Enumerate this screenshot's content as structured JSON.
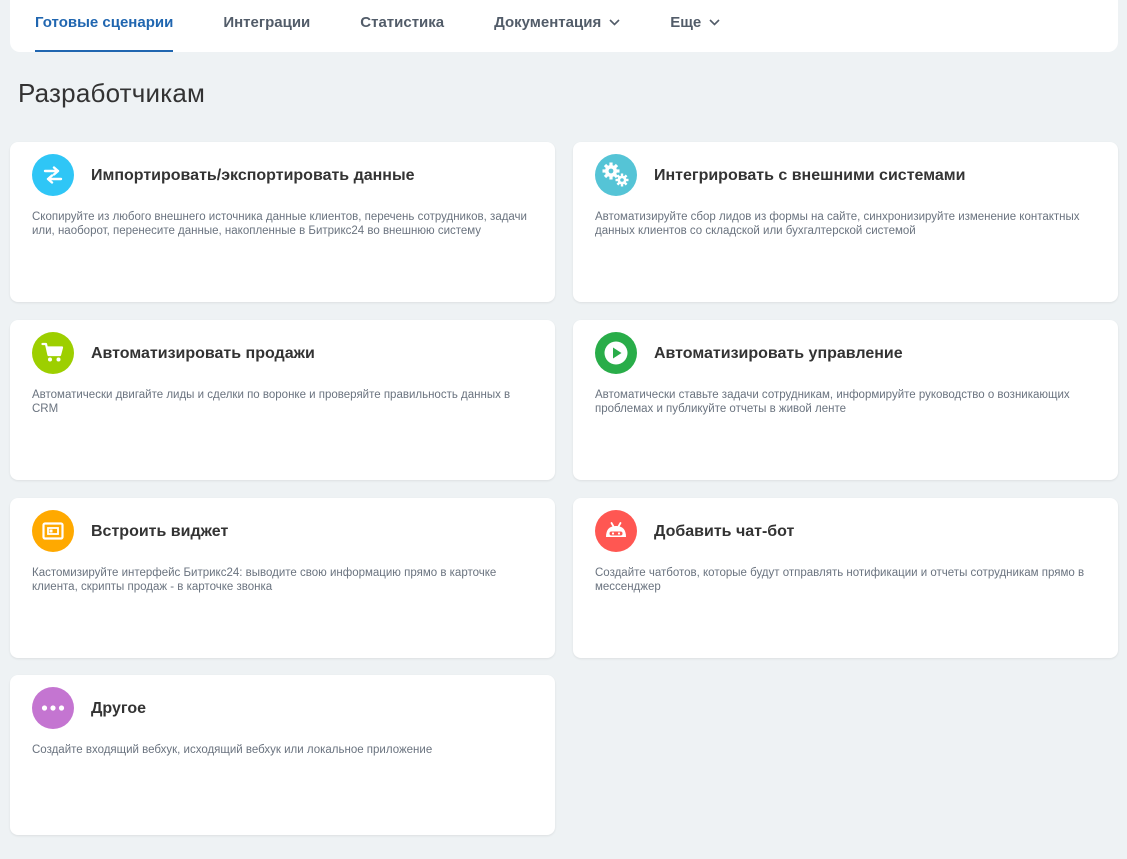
{
  "nav": {
    "tabs": [
      {
        "label": "Готовые сценарии",
        "active": true
      },
      {
        "label": "Интеграции"
      },
      {
        "label": "Статистика"
      },
      {
        "label": "Документация"
      },
      {
        "label": "Еще"
      }
    ]
  },
  "page": {
    "title": "Разработчикам"
  },
  "cards": [
    {
      "title": "Импортировать/экспортировать данные",
      "desc": "Скопируйте из любого внешнего источника данные клиентов, перечень сотрудников, задачи или, наоборот, перенесите данные, накопленные в Битрикс24 во внешнюю систему",
      "icon": "arrows-exchange-icon",
      "color": "#2fc6f6"
    },
    {
      "title": "Интегрировать с внешними системами",
      "desc": "Автоматизируйте сбор лидов из формы на сайте, синхронизируйте изменение контактных данных клиентов со складской или бухгалтерской системой",
      "icon": "gears-icon",
      "color": "#55c4d6"
    },
    {
      "title": "Автоматизировать продажи",
      "desc": "Автоматически двигайте лиды и сделки по воронке и проверяйте правильность данных в CRM",
      "icon": "cart-icon",
      "color": "#9dcf00"
    },
    {
      "title": "Автоматизировать управление",
      "desc": "Автоматически ставьте задачи сотрудникам, информируйте руководство о возникающих проблемах и публикуйте отчеты в живой ленте",
      "icon": "play-icon",
      "color": "#29ad49"
    },
    {
      "title": "Встроить виджет",
      "desc": "Кастомизируйте интерфейс Битрикс24: выводите свою информацию прямо в карточке клиента, скрипты продаж - в карточке звонка",
      "icon": "widget-icon",
      "color": "#ffa900"
    },
    {
      "title": "Добавить чат-бот",
      "desc": "Создайте чатботов, которые будут отправлять нотификации и отчеты сотрудникам прямо в мессенджер",
      "icon": "robot-icon",
      "color": "#ff5752"
    },
    {
      "title": "Другое",
      "desc": "Создайте входящий вебхук, исходящий вебхук или локальное приложение",
      "icon": "dots-icon",
      "color": "#c475d1"
    }
  ]
}
